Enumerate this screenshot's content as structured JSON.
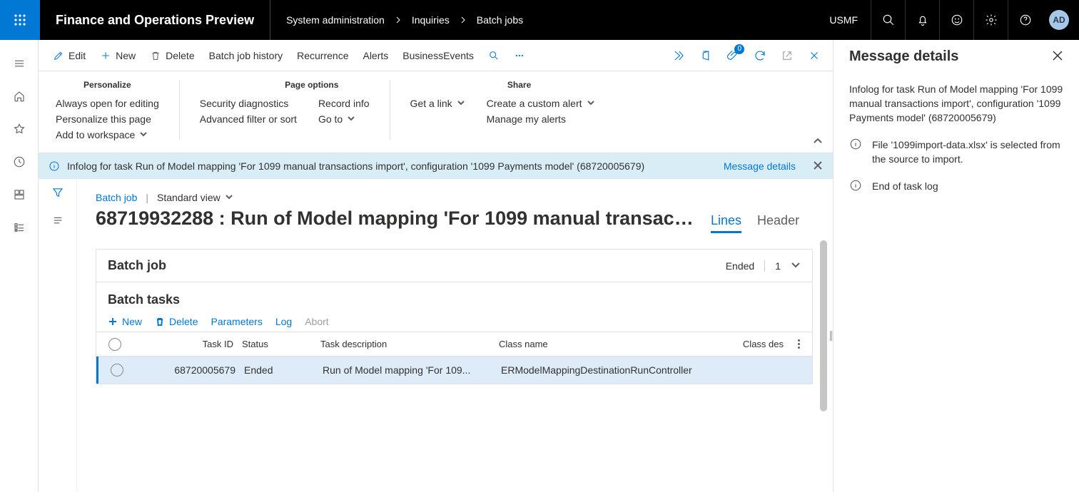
{
  "header": {
    "app_title": "Finance and Operations Preview",
    "crumbs": [
      "System administration",
      "Inquiries",
      "Batch jobs"
    ],
    "company": "USMF",
    "avatar": "AD"
  },
  "actionbar": {
    "edit": "Edit",
    "new": "New",
    "delete": "Delete",
    "items": [
      "Batch job history",
      "Recurrence",
      "Alerts",
      "BusinessEvents"
    ],
    "attach_count": "0"
  },
  "options": {
    "personalize": {
      "hd": "Personalize",
      "items": [
        "Always open for editing",
        "Personalize this page",
        "Add to workspace"
      ]
    },
    "page": {
      "hd": "Page options",
      "items_l": [
        "Security diagnostics",
        "Advanced filter or sort"
      ],
      "items_r": [
        "Record info",
        "Go to"
      ]
    },
    "share": {
      "hd": "Share",
      "items_l": [
        "Get a link"
      ],
      "items_r": [
        "Create a custom alert",
        "Manage my alerts"
      ]
    }
  },
  "infobar": {
    "text": "Infolog for task Run of Model mapping 'For 1099 manual transactions import', configuration '1099 Payments model' (68720005679)",
    "link": "Message details"
  },
  "page": {
    "breadcrumb": "Batch job",
    "view": "Standard view",
    "title": "68719932288 : Run of Model mapping 'For 1099 manual transaction...",
    "tabs": {
      "lines": "Lines",
      "header": "Header"
    },
    "card_hd": "Batch job",
    "status": "Ended",
    "count": "1",
    "subhd": "Batch tasks",
    "tbl_actions": {
      "new": "New",
      "delete": "Delete",
      "params": "Parameters",
      "log": "Log",
      "abort": "Abort"
    },
    "cols": {
      "taskid": "Task ID",
      "status": "Status",
      "desc": "Task description",
      "class": "Class name",
      "classdes": "Class des"
    },
    "row": {
      "taskid": "68720005679",
      "status": "Ended",
      "desc": "Run of Model mapping 'For 109...",
      "class": "ERModelMappingDestinationRunController"
    }
  },
  "panel": {
    "title": "Message details",
    "sub": "Infolog for task Run of Model mapping 'For 1099 manual transactions import', configuration '1099 Payments model' (68720005679)",
    "m1": "File '1099import-data.xlsx' is selected from the source to import.",
    "m2": "End of task log"
  }
}
